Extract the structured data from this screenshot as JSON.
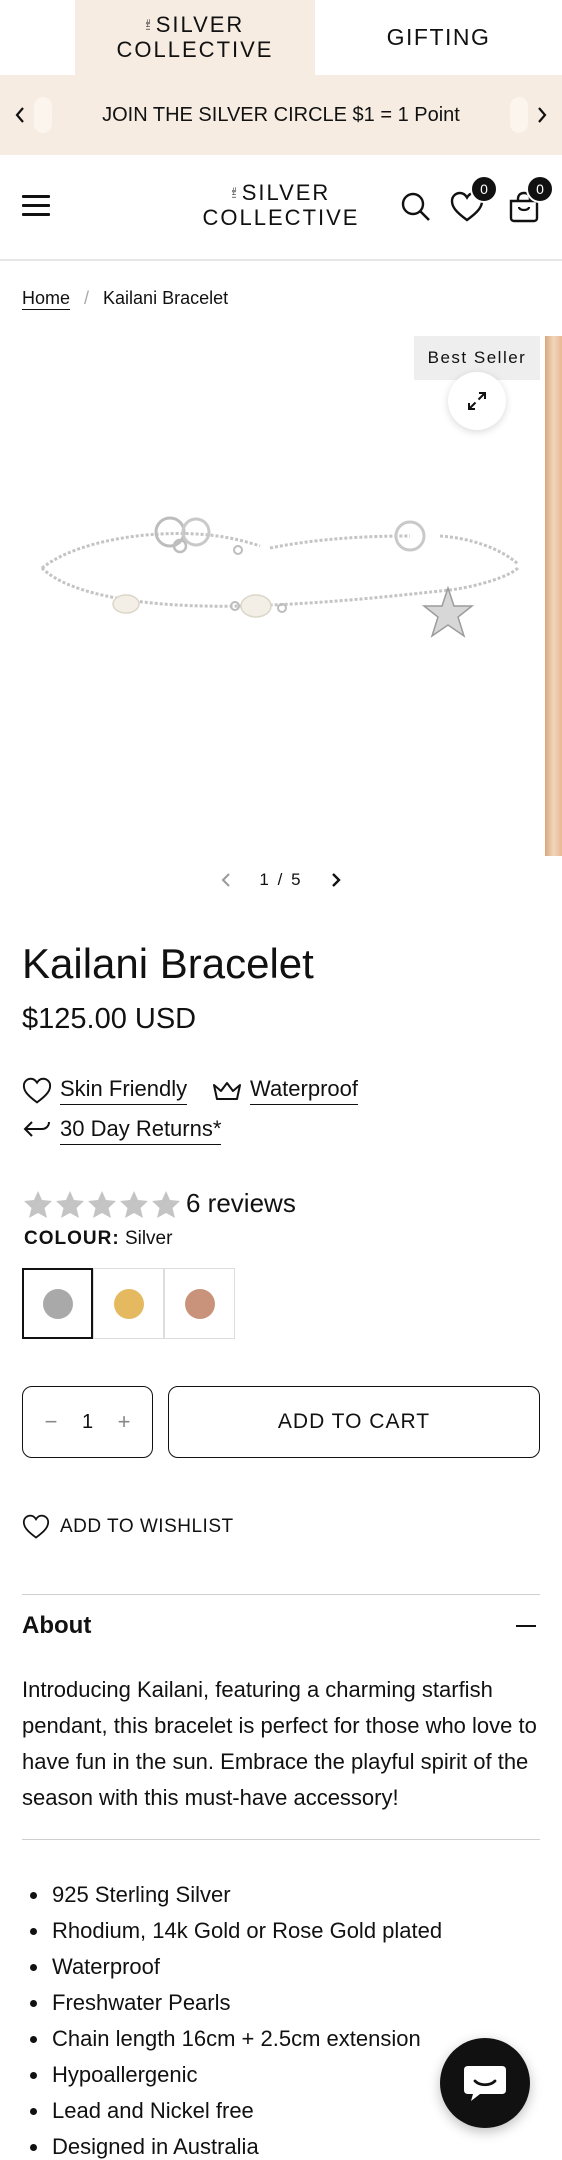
{
  "brand_tabs": {
    "active": {
      "the": "THE",
      "line1": "SILVER",
      "line2": "COLLECTIVE"
    },
    "other": "GIFTING"
  },
  "announcement": {
    "text": "JOIN THE SILVER CIRCLE $1 = 1 Point",
    "prev_icon": "chevron-left-icon",
    "next_icon": "chevron-right-icon"
  },
  "header": {
    "logo": {
      "the": "THE",
      "line1": "SILVER",
      "line2": "COLLECTIVE"
    },
    "wishlist_count": "0",
    "cart_count": "0"
  },
  "breadcrumb": {
    "home": "Home",
    "separator": "/",
    "current": "Kailani Bracelet"
  },
  "gallery": {
    "badge": "Best Seller",
    "current": "1",
    "total": "5",
    "separator": "/"
  },
  "product": {
    "title": "Kailani Bracelet",
    "price": "$125.00 USD",
    "features": [
      {
        "label": "Skin Friendly",
        "icon": "heart-icon"
      },
      {
        "label": "Waterproof",
        "icon": "crown-icon"
      },
      {
        "label": "30 Day Returns*",
        "icon": "return-arrow-icon"
      }
    ],
    "rating": 5,
    "reviews": "6 reviews",
    "colour_label": "COLOUR:",
    "colour_value": "Silver",
    "swatches": [
      {
        "name": "Silver",
        "color": "#a9a9a9"
      },
      {
        "name": "Gold",
        "color": "#e4b95f"
      },
      {
        "name": "Rose Gold",
        "color": "#c9927a"
      }
    ],
    "quantity": "1",
    "qty_minus": "−",
    "qty_plus": "+",
    "add_to_cart": "ADD TO CART",
    "add_to_wishlist": "ADD TO WISHLIST"
  },
  "about": {
    "title": "About",
    "text": "Introducing Kailani, featuring a charming starfish pendant, this bracelet is perfect for those who love to have fun in the sun. Embrace the playful spirit of the season with this must-have accessory!",
    "list": [
      "925 Sterling Silver",
      "Rhodium, 14k Gold or Rose Gold plated",
      "Waterproof",
      "Freshwater Pearls",
      "Chain length 16cm + 2.5cm extension",
      "Hypoallergenic",
      "Lead and Nickel free",
      "Designed in Australia"
    ]
  },
  "colors": {
    "cream": "#f6ece2",
    "text": "#111111",
    "divider": "#cfcfcf"
  }
}
